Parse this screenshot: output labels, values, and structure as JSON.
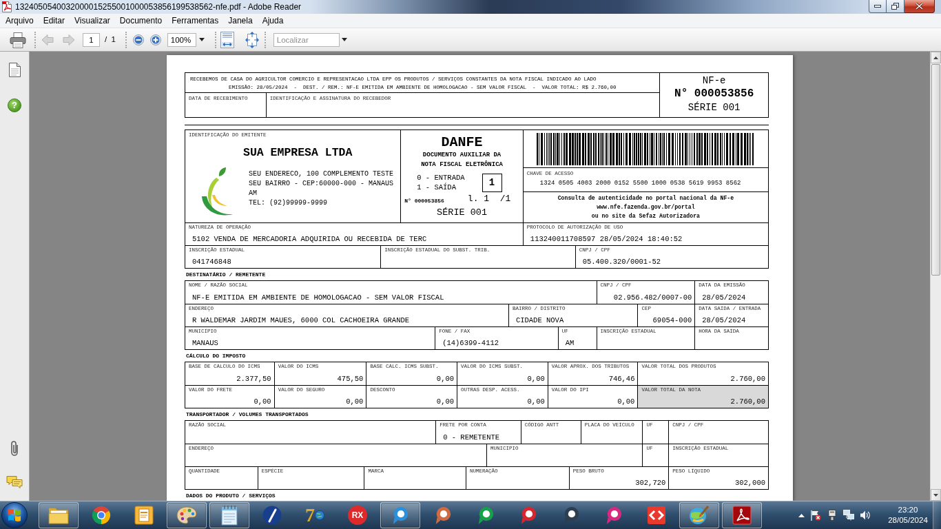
{
  "window": {
    "title": "1324050540032000015255001000053856199538562-nfe.pdf - Adobe Reader"
  },
  "menu": [
    "Arquivo",
    "Editar",
    "Visualizar",
    "Documento",
    "Ferramentas",
    "Janela",
    "Ajuda"
  ],
  "toolbar": {
    "nav": [
      {
        "kind": "previous",
        "disabled": true
      },
      {
        "kind": "next",
        "disabled": true
      }
    ],
    "page": "1",
    "page_total": "/ 1",
    "zoom": "100%",
    "find": {
      "placeholder": "Localizar"
    }
  },
  "sidebar": {
    "help": "?"
  },
  "document": {
    "receipt": {
      "lines": [
        "RECEBEMOS DE CASA DO AGRICULTOR COMERCIO E REPRESENTACAO LTDA EPP OS PRODUTOS / SERVIÇOS CONSTANTES DA NOTA FISCAL INDICADO AO LADO",
        "EMISSÃO: 28/05/2024  -  DEST. / REM.: NF-E EMITIDA EM AMBIENTE DE HOMOLOGACAO - SEM VALOR FISCAL  -  VALOR TOTAL: R$ 2.760,00"
      ],
      "fields": [
        {
          "label": "DATA DE RECEBIMENTO"
        },
        {
          "label": "IDENTIFICAÇÃO E ASSINATURA DO RECEBEDOR"
        }
      ],
      "nfe": {
        "title": "NF-e",
        "number": "N° 000053856",
        "series": "SÉRIE 001"
      }
    },
    "issuer": {
      "label": "IDENTIFICAÇÃO DO EMITENTE",
      "name": "SUA EMPRESA LTDA",
      "address": [
        "SEU ENDERECO, 100 COMPLEMENTO TESTE",
        "SEU BAIRRO - CEP:60000-000 - MANAUS",
        "AM",
        "TEL: (92)99999-9999"
      ]
    },
    "danfe": {
      "title": "DANFE",
      "subtitle": [
        "DOCUMENTO AUXILIAR DA",
        "NOTA FISCAL ELETRÔNICA"
      ],
      "options": [
        "0 - ENTRADA",
        "1 - SAÍDA"
      ],
      "type": "1",
      "number": "N° 000053856",
      "sheet": "l. 1  /1",
      "series": "SÉRIE 001"
    },
    "access_key": {
      "label": "CHAVE DE ACESSO",
      "value": "1324 0505 4003 2000 0152 5500 1000 0538 5619 9953 8562"
    },
    "consult": [
      "Consulta de autenticidade no portal nacional da NF-e",
      "www.nfe.fazenda.gov.br/portal",
      "ou no site da Sefaz Autorizadora"
    ],
    "sections": [
      {
        "rows": [
          {
            "fields": [
              {
                "kind": "text",
                "label": "NATUREZA DE OPERAÇÃO",
                "value": "5102 VENDA DE MERCADORIA ADQUIRIDA OU RECEBIDA DE TERC"
              },
              {
                "kind": "text",
                "label": "PROTOCOLO DE AUTORIZAÇÃO DE USO",
                "value": "113240011708597 28/05/2024 18:40:52"
              }
            ]
          },
          {
            "fields": [
              {
                "kind": "text",
                "label": "INSCRIÇÃO ESTADUAL",
                "value": "041746848"
              },
              {
                "kind": "text",
                "label": "INSCRIÇÃO ESTADUAL DO SUBST. TRIB."
              },
              {
                "kind": "text",
                "label": "CNPJ / CPF",
                "value": "05.400.320/0001-52"
              }
            ]
          }
        ]
      },
      {
        "title": "DESTINATÁRIO / REMETENTE",
        "rows": [
          {
            "fields": [
              {
                "kind": "text",
                "label": "NOME / RAZÃO SOCIAL",
                "value": "NF-E EMITIDA EM AMBIENTE DE HOMOLOGACAO - SEM VALOR FISCAL"
              },
              {
                "kind": "number",
                "label": "CNPJ / CPF",
                "value": "02.956.482/0007-00"
              },
              {
                "kind": "text",
                "label": "DATA DA EMISSÃO",
                "value": "28/05/2024"
              }
            ]
          },
          {
            "fields": [
              {
                "kind": "text",
                "label": "ENDEREÇO",
                "value": "R WALDEMAR JARDIM MAUES, 6000 COL CACHOEIRA GRANDE"
              },
              {
                "kind": "text",
                "label": "BAIRRO / DISTRITO",
                "value": "CIDADE NOVA"
              },
              {
                "kind": "number",
                "label": "CEP",
                "value": "69054-000"
              },
              {
                "kind": "text",
                "label": "DATA SAÍDA / ENTRADA",
                "value": "28/05/2024"
              }
            ]
          },
          {
            "fields": [
              {
                "kind": "text",
                "label": "MUNICÍPIO",
                "value": "MANAUS"
              },
              {
                "kind": "text",
                "label": "FONE / FAX",
                "value": "(14)6399-4112"
              },
              {
                "kind": "text",
                "label": "UF",
                "value": "AM"
              },
              {
                "kind": "text",
                "label": "INSCRIÇÃO ESTADUAL"
              },
              {
                "kind": "text",
                "label": "HORA DA SAÍDA"
              }
            ]
          }
        ]
      },
      {
        "title": "CÁLCULO DO IMPOSTO",
        "rows": [
          {
            "fields": [
              {
                "kind": "number",
                "label": "BASE DE CÁLCULO DO ICMS",
                "value": "2.377,50",
                "highlighted": false
              },
              {
                "kind": "number",
                "label": "VALOR DO ICMS",
                "value": "475,50",
                "highlighted": false
              },
              {
                "kind": "number",
                "label": "BASE CÁLC. ICMS SUBST.",
                "value": "0,00",
                "highlighted": false
              },
              {
                "kind": "number",
                "label": "VALOR DO ICMS SUBST.",
                "value": "0,00",
                "highlighted": false
              },
              {
                "kind": "number",
                "label": "VALOR APROX. DOS TRIBUTOS",
                "value": "746,46",
                "highlighted": false
              },
              {
                "kind": "number",
                "label": "VALOR TOTAL DOS PRODUTOS",
                "value": "2.760,00",
                "highlighted": false
              }
            ]
          },
          {
            "fields": [
              {
                "kind": "number",
                "label": "VALOR DO FRETE",
                "value": "0,00",
                "highlighted": false
              },
              {
                "kind": "number",
                "label": "VALOR DO SEGURO",
                "value": "0,00",
                "highlighted": false
              },
              {
                "kind": "number",
                "label": "DESCONTO",
                "value": "0,00",
                "highlighted": false
              },
              {
                "kind": "number",
                "label": "OUTRAS DESP. ACESS.",
                "value": "0,00",
                "highlighted": false
              },
              {
                "kind": "number",
                "label": "VALOR DO IPI",
                "value": "0,00",
                "highlighted": false
              },
              {
                "kind": "number",
                "label": "VALOR TOTAL DA NOTA",
                "value": "2.760,00",
                "highlighted": true
              }
            ]
          }
        ]
      },
      {
        "title": "TRANSPORTADOR / VOLUMES TRANSPORTADOS",
        "rows": [
          {
            "fields": [
              {
                "kind": "text",
                "label": "RAZÃO SOCIAL"
              },
              {
                "kind": "text",
                "label": "FRETE POR CONTA",
                "value": "0 - REMETENTE"
              },
              {
                "kind": "text",
                "label": "CÓDIGO ANTT"
              },
              {
                "kind": "text",
                "label": "PLACA DO VEÍCULO"
              },
              {
                "kind": "text",
                "label": "UF"
              },
              {
                "kind": "text",
                "label": "CNPJ / CPF"
              }
            ]
          },
          {
            "fields": [
              {
                "kind": "text",
                "label": "ENDEREÇO"
              },
              {
                "kind": "text",
                "label": "MUNICÍPIO"
              },
              {
                "kind": "text",
                "label": "UF"
              },
              {
                "kind": "text",
                "label": "INSCRIÇÃO ESTADUAL"
              }
            ]
          },
          {
            "fields": [
              {
                "kind": "text",
                "label": "QUANTIDADE"
              },
              {
                "kind": "text",
                "label": "ESPÉCIE"
              },
              {
                "kind": "text",
                "label": "MARCA"
              },
              {
                "kind": "text",
                "label": "NUMERAÇÃO"
              },
              {
                "kind": "number",
                "label": "PESO BRUTO",
                "value": "302,720"
              },
              {
                "kind": "number",
                "label": "PESO LÍQUIDO",
                "value": "302,000"
              }
            ]
          }
        ]
      },
      {
        "title": "DADOS DO PRODUTO / SERVIÇOS"
      }
    ]
  },
  "taskbar": {
    "items": [
      {
        "kind": "folder",
        "running": true
      },
      {
        "kind": "tricolor",
        "running": false
      },
      {
        "kind": "tile",
        "running": false
      },
      {
        "kind": "palette",
        "running": true
      },
      {
        "kind": "notepad",
        "running": true
      },
      {
        "kind": "slash",
        "running": false
      },
      {
        "kind": "seven",
        "text": "7",
        "running": false
      },
      {
        "kind": "rx",
        "text": "RX",
        "running": false
      },
      {
        "kind": "ring",
        "color": "#2a8fdc",
        "running": true
      },
      {
        "kind": "ring",
        "color": "#cf6b43",
        "running": false
      },
      {
        "kind": "ring",
        "color": "#16a04a",
        "running": false
      },
      {
        "kind": "ring",
        "color": "#d9262e",
        "running": false
      },
      {
        "kind": "ring",
        "color": "#2d3e50",
        "running": false
      },
      {
        "kind": "ring",
        "color": "#d8287f",
        "running": false
      },
      {
        "kind": "arrows",
        "running": false
      },
      {
        "kind": "brush",
        "running": true
      },
      {
        "kind": "pdf",
        "running": true
      }
    ],
    "clock": {
      "time": "23:20",
      "date": "28/05/2024"
    }
  }
}
